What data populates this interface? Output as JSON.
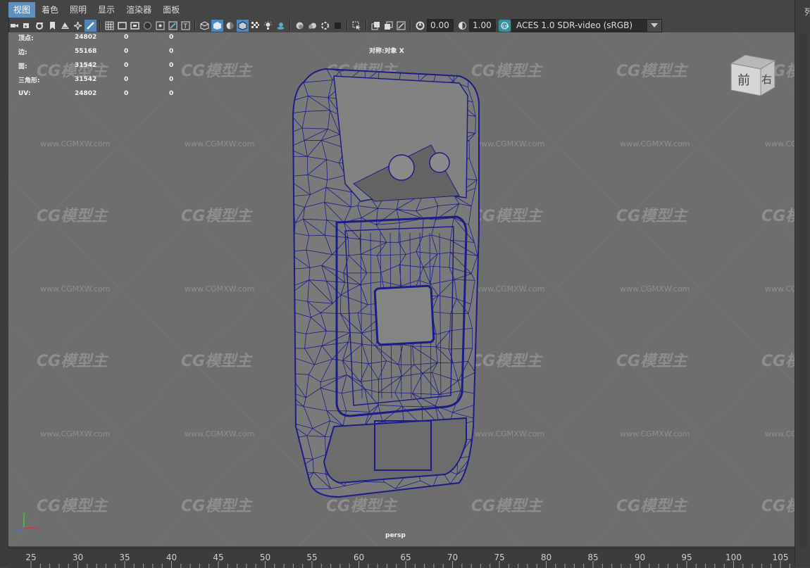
{
  "menu": [
    "视图",
    "着色",
    "照明",
    "显示",
    "渲染器",
    "面板"
  ],
  "toolbar": {
    "exposure_value": "0.00",
    "gamma_value": "1.00",
    "color_space": "ACES 1.0 SDR-video (sRGB)"
  },
  "hud": {
    "rows": [
      {
        "label": "顶点:",
        "v1": "24802",
        "v2": "0",
        "v3": "0"
      },
      {
        "label": "边:",
        "v1": "55168",
        "v2": "0",
        "v3": "0"
      },
      {
        "label": "面:",
        "v1": "31542",
        "v2": "0",
        "v3": "0"
      },
      {
        "label": "三角形:",
        "v1": "31542",
        "v2": "0",
        "v3": "0"
      },
      {
        "label": "UV:",
        "v1": "24802",
        "v2": "0",
        "v3": "0"
      }
    ]
  },
  "symmetry_label": "对称:对象 X",
  "camera_label": "persp",
  "view_cube": {
    "front": "前",
    "right": "右"
  },
  "right_panel_label": "列",
  "watermark": {
    "logo": "CG模型主",
    "url": "www.CGMXW.com"
  },
  "timeline": {
    "ticks": [
      "25",
      "30",
      "35",
      "40",
      "45",
      "50",
      "55",
      "60",
      "65",
      "70",
      "75",
      "80",
      "85",
      "90",
      "95",
      "100",
      "105"
    ]
  },
  "colors": {
    "wireframe": "#1c1c8a",
    "accent": "#5e8fbf",
    "viewport": "#6e6e6e"
  }
}
